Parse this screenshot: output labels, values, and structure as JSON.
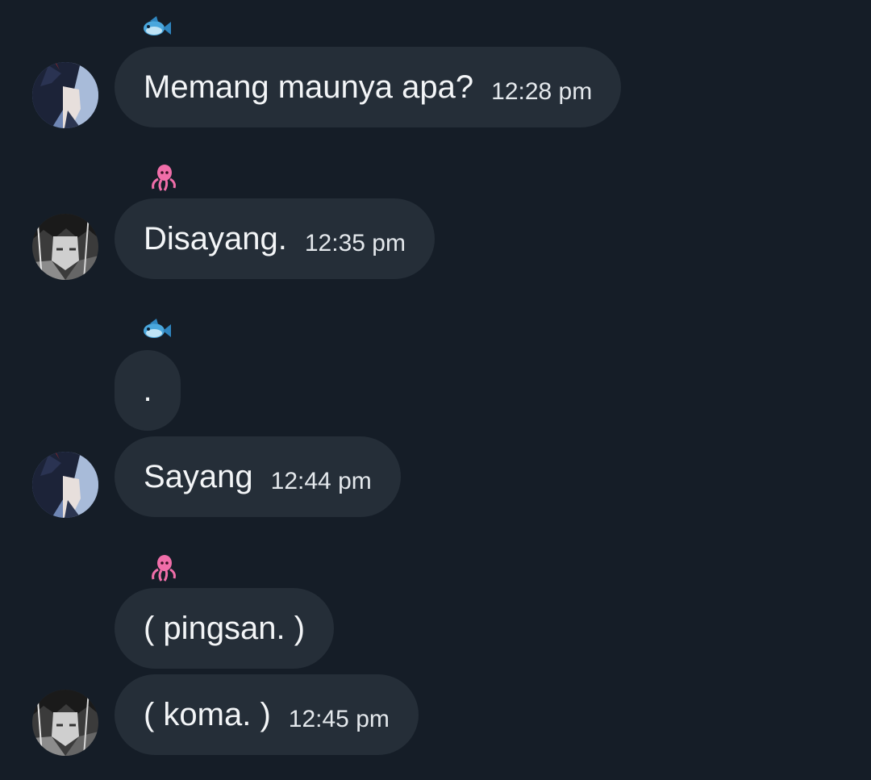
{
  "colors": {
    "background": "#151d27",
    "bubble": "#252e38",
    "text": "#f3f5f7",
    "fish": "#4aa7dd",
    "squid": "#f06ea9"
  },
  "messages": [
    {
      "sender_icon": "fish-icon",
      "avatar": "dark-haired-boy-avatar",
      "text": "Memang maunya apa?",
      "time": "12:28 pm"
    },
    {
      "sender_icon": "squid-icon",
      "avatar": "grey-haired-boy-avatar",
      "text": "Disayang.",
      "time": "12:35 pm"
    },
    {
      "sender_icon": "fish-icon",
      "avatar": null,
      "text": ".",
      "time": ""
    },
    {
      "sender_icon": null,
      "avatar": "dark-haired-boy-avatar",
      "text": "Sayang",
      "time": "12:44 pm"
    },
    {
      "sender_icon": "squid-icon",
      "avatar": null,
      "text": "( pingsan. )",
      "time": ""
    },
    {
      "sender_icon": null,
      "avatar": "grey-haired-boy-avatar",
      "text": "( koma. )",
      "time": "12:45 pm"
    }
  ]
}
